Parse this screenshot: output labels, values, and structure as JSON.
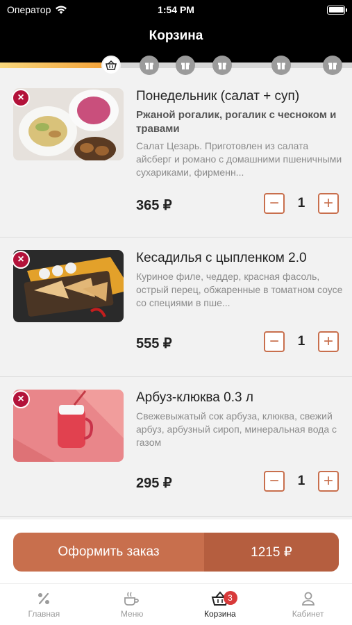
{
  "statusbar": {
    "carrier": "Оператор",
    "time": "1:54 PM"
  },
  "header": {
    "title": "Корзина"
  },
  "progress": {
    "fill_fraction": 0.29,
    "milestones": [
      "basket-icon",
      "gift-icon",
      "gift-icon",
      "gift-icon",
      "gift-icon",
      "gift-icon"
    ]
  },
  "cart": {
    "items": [
      {
        "title": "Понедельник (салат + суп)",
        "subtitle": "Ржаной рогалик, рогалик с чесноком и травами",
        "description": "Салат Цезарь. Приготовлен из салата айсберг и романо с домашними пшеничными сухариками, фирменн...",
        "price": "365 ₽",
        "qty": "1"
      },
      {
        "title": "Кесадилья с цыпленком 2.0",
        "description": "Куриное филе, чеддер, красная фасоль, острый перец, обжаренные в томатном соусе со специями в пше...",
        "price": "555 ₽",
        "qty": "1"
      },
      {
        "title": "Арбуз-клюква 0.3 л",
        "description": "Свежевыжатый сок арбуза, клюква, свежий арбуз, арбузный сироп, минеральная вода с газом",
        "price": "295 ₽",
        "qty": "1"
      }
    ],
    "minus": "−",
    "plus": "+",
    "remove": "×"
  },
  "checkout": {
    "label": "Оформить заказ",
    "total": "1215 ₽"
  },
  "tabs": [
    {
      "label": "Главная",
      "icon": "percent-icon"
    },
    {
      "label": "Меню",
      "icon": "menu-icon"
    },
    {
      "label": "Корзина",
      "icon": "basket-icon",
      "badge": "3"
    },
    {
      "label": "Кабинет",
      "icon": "profile-icon"
    }
  ],
  "colors": {
    "accent": "#c86f4d",
    "accent_dark": "#b55e3f",
    "remove": "#b3123a",
    "badge": "#d83a3a"
  }
}
